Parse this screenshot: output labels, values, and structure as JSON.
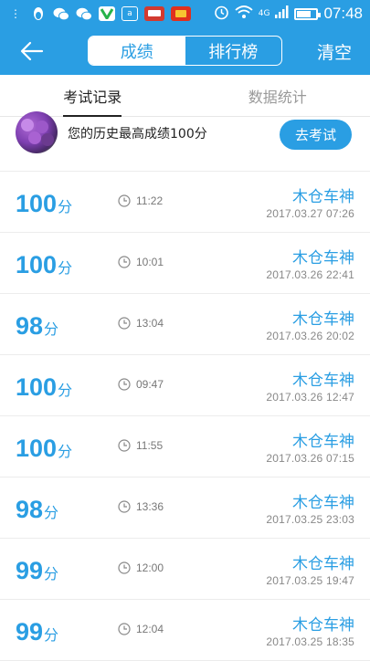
{
  "status_bar": {
    "network": "4G",
    "battery_level": 0.72,
    "time": "07:48",
    "notification_icons": [
      "overflow-dots-icon",
      "qq-penguin-icon",
      "wechat-icon",
      "wechat-icon",
      "green-app-icon",
      "square-app-icon",
      "red-app-icon",
      "red-app-icon"
    ]
  },
  "app_bar": {
    "back_icon": "back-arrow-icon",
    "segments": [
      {
        "label": "成绩",
        "active": true
      },
      {
        "label": "排行榜",
        "active": false
      }
    ],
    "clear_label": "清空"
  },
  "tabs": [
    {
      "label": "考试记录",
      "active": true
    },
    {
      "label": "数据统计",
      "active": false
    }
  ],
  "profile": {
    "best_text": "您的历史最高成绩100分",
    "exam_button": "去考试"
  },
  "records": [
    {
      "score": "100",
      "unit": "分",
      "duration": "11:22",
      "name": "木仓车神",
      "date": "2017.03.27  07:26"
    },
    {
      "score": "100",
      "unit": "分",
      "duration": "10:01",
      "name": "木仓车神",
      "date": "2017.03.26  22:41"
    },
    {
      "score": "98",
      "unit": "分",
      "duration": "13:04",
      "name": "木仓车神",
      "date": "2017.03.26  20:02"
    },
    {
      "score": "100",
      "unit": "分",
      "duration": "09:47",
      "name": "木仓车神",
      "date": "2017.03.26  12:47"
    },
    {
      "score": "100",
      "unit": "分",
      "duration": "11:55",
      "name": "木仓车神",
      "date": "2017.03.26  07:15"
    },
    {
      "score": "98",
      "unit": "分",
      "duration": "13:36",
      "name": "木仓车神",
      "date": "2017.03.25  23:03"
    },
    {
      "score": "99",
      "unit": "分",
      "duration": "12:00",
      "name": "木仓车神",
      "date": "2017.03.25  19:47"
    },
    {
      "score": "99",
      "unit": "分",
      "duration": "12:04",
      "name": "木仓车神",
      "date": "2017.03.25  18:35"
    }
  ],
  "colors": {
    "primary": "#2a9ee3",
    "text_dark": "#222222",
    "text_muted": "#888888"
  }
}
